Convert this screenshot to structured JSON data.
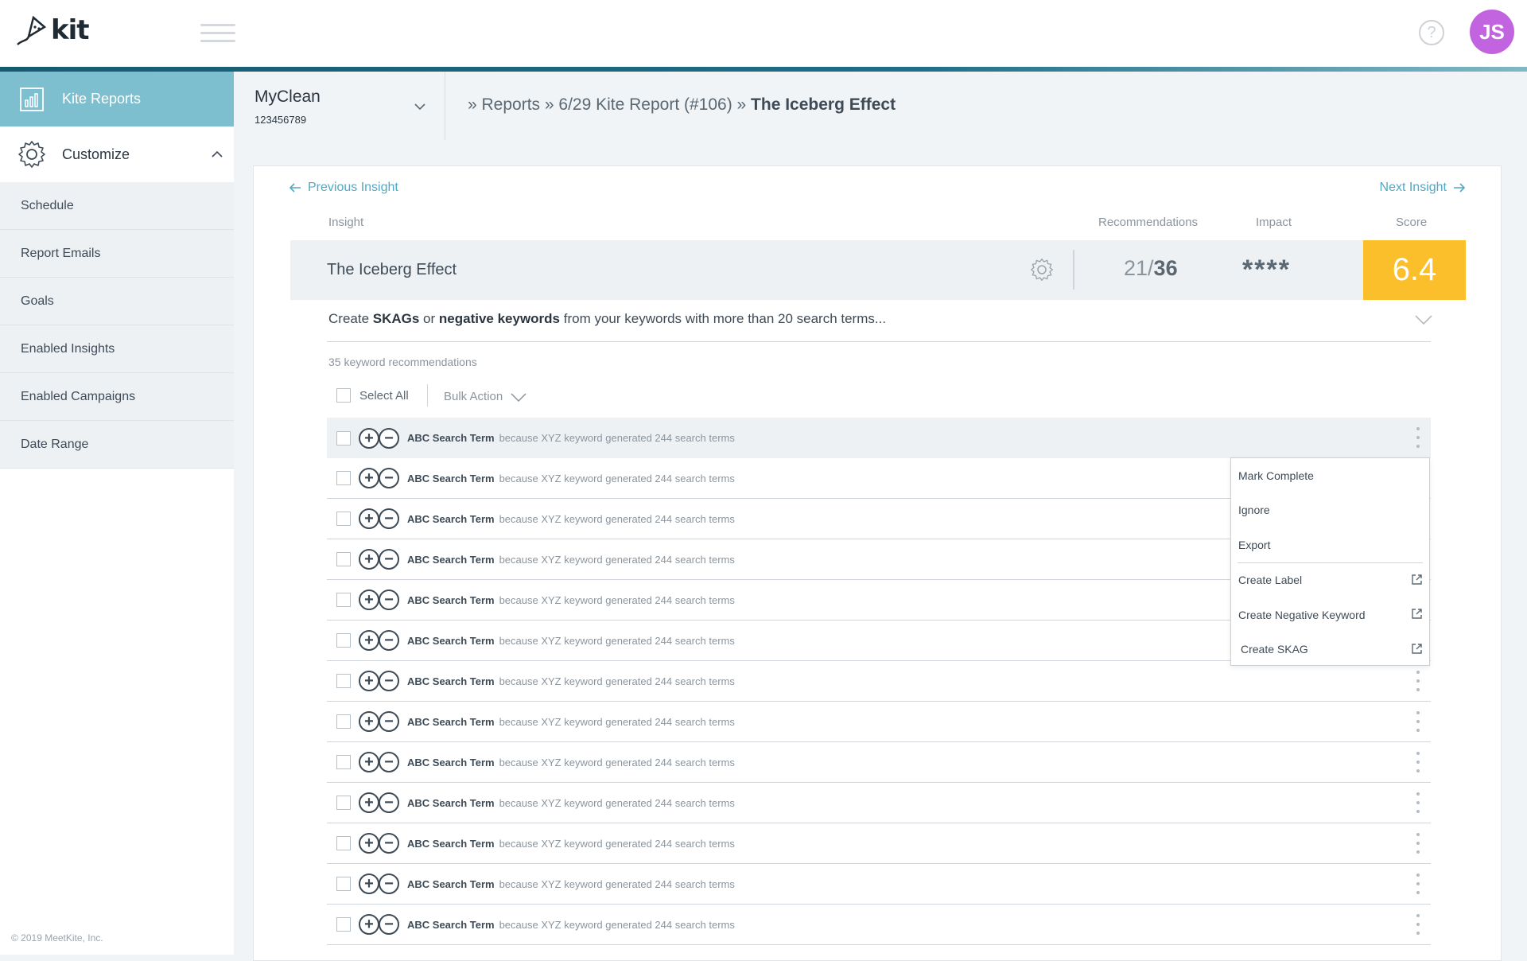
{
  "header": {
    "logo_text": "kit",
    "help_glyph": "?",
    "avatar_initials": "JS",
    "avatar_color": "#c264e0"
  },
  "sidebar": {
    "kite_reports": "Kite Reports",
    "customize": "Customize",
    "items": [
      {
        "label": "Schedule"
      },
      {
        "label": "Report Emails"
      },
      {
        "label": "Goals"
      },
      {
        "label": "Enabled Insights"
      },
      {
        "label": "Enabled Campaigns"
      },
      {
        "label": "Date Range"
      }
    ],
    "copyright": "© 2019 MeetKite, Inc."
  },
  "account": {
    "name": "MyClean",
    "id": "123456789"
  },
  "breadcrumb": {
    "prefix": "» Reports » 6/29 Kite Report (#106) » ",
    "current": "The Iceberg Effect"
  },
  "nav": {
    "previous": "Previous Insight",
    "next": "Next Insight"
  },
  "columns": {
    "insight": "Insight",
    "recommendations": "Recommendations",
    "impact": "Impact",
    "score": "Score"
  },
  "insight": {
    "title": "The Iceberg Effect",
    "rec_done": "21/",
    "rec_total": "36",
    "impact_stars": "****",
    "score": "6.4",
    "score_color": "#fbbf2b"
  },
  "description": {
    "t1": "Create ",
    "b1": "SKAGs",
    "t2": " or ",
    "b2": "negative keywords",
    "t3": " from your keywords with more than 20 search terms..."
  },
  "keyword_count": "35 keyword recommendations",
  "controls": {
    "select_all": "Select All",
    "bulk_action": "Bulk Action"
  },
  "rows": [
    {
      "term": "ABC Search Term",
      "reason": "because XYZ keyword generated 244 search terms"
    },
    {
      "term": "ABC Search Term",
      "reason": "because XYZ keyword generated 244 search terms"
    },
    {
      "term": "ABC Search Term",
      "reason": "because XYZ keyword generated 244 search terms"
    },
    {
      "term": "ABC Search Term",
      "reason": "because XYZ keyword generated 244 search terms"
    },
    {
      "term": "ABC Search Term",
      "reason": "because XYZ keyword generated 244 search terms"
    },
    {
      "term": "ABC Search Term",
      "reason": "because XYZ keyword generated 244 search terms"
    },
    {
      "term": "ABC Search Term",
      "reason": "because XYZ keyword generated 244 search terms"
    },
    {
      "term": "ABC Search Term",
      "reason": "because XYZ keyword generated 244 search terms"
    },
    {
      "term": "ABC Search Term",
      "reason": "because XYZ keyword generated 244 search terms"
    },
    {
      "term": "ABC Search Term",
      "reason": "because XYZ keyword generated 244 search terms"
    },
    {
      "term": "ABC Search Term",
      "reason": "because XYZ keyword generated 244 search terms"
    },
    {
      "term": "ABC Search Term",
      "reason": "because XYZ keyword generated 244 search terms"
    },
    {
      "term": "ABC Search Term",
      "reason": "because XYZ keyword generated 244 search terms"
    }
  ],
  "menu": {
    "mark_complete": "Mark Complete",
    "ignore": "Ignore",
    "export": "Export",
    "create_label": "Create Label",
    "create_negative_keyword": "Create Negative Keyword",
    "create_skag": "Create SKAG"
  },
  "colors": {
    "accent": "#52aac2",
    "sidebar_active": "#7ebfcf"
  }
}
